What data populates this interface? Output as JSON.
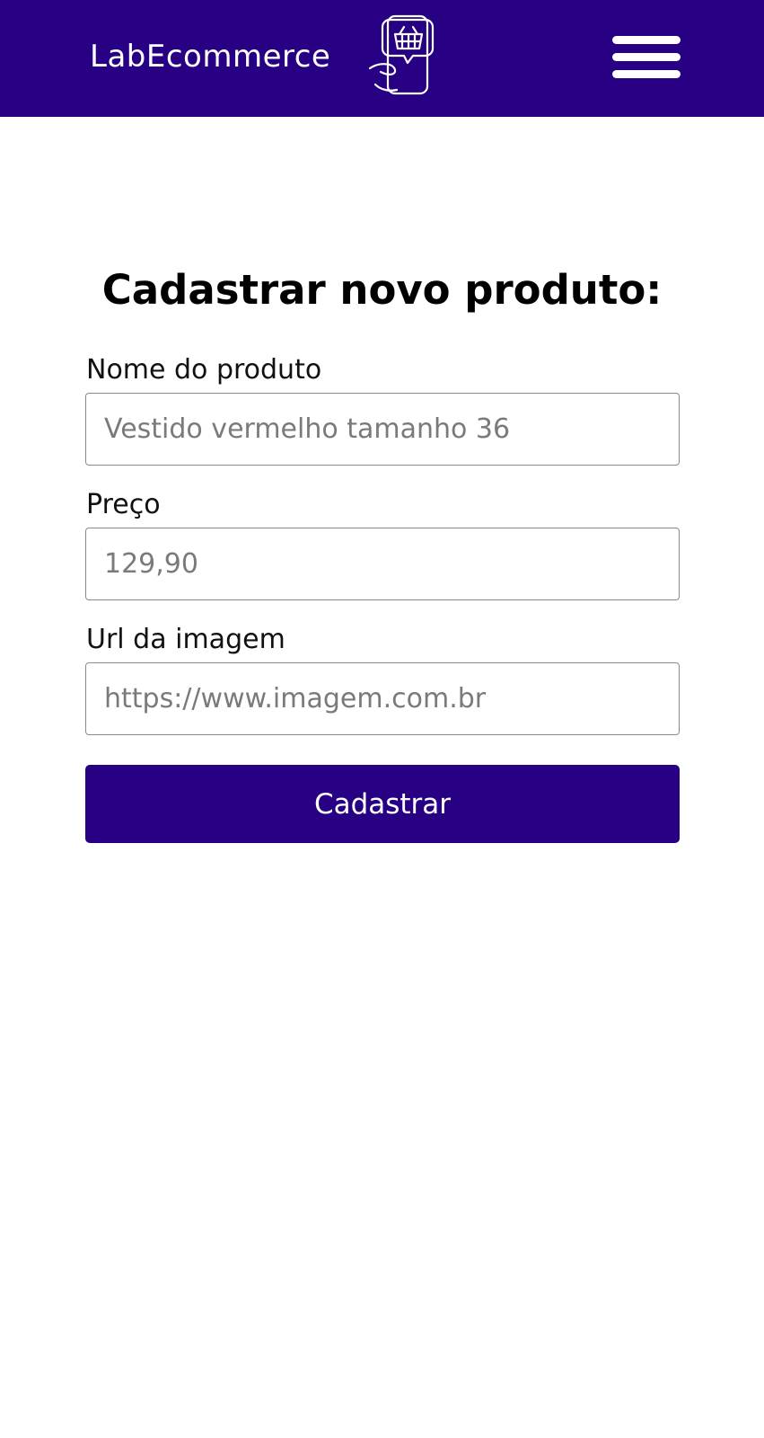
{
  "header": {
    "brand_name": "LabEcommerce",
    "logo_icon": "hand-holding-phone-with-basket-icon",
    "menu_icon": "hamburger-menu-icon",
    "background_color": "#270083"
  },
  "form": {
    "title": "Cadastrar novo produto:",
    "fields": [
      {
        "label": "Nome do produto",
        "placeholder": "Vestido vermelho tamanho 36",
        "value": ""
      },
      {
        "label": "Preço",
        "placeholder": "129,90",
        "value": ""
      },
      {
        "label": "Url da imagem",
        "placeholder": "https://www.imagem.com.br",
        "value": ""
      }
    ],
    "submit_label": "Cadastrar",
    "submit_color": "#270083"
  }
}
